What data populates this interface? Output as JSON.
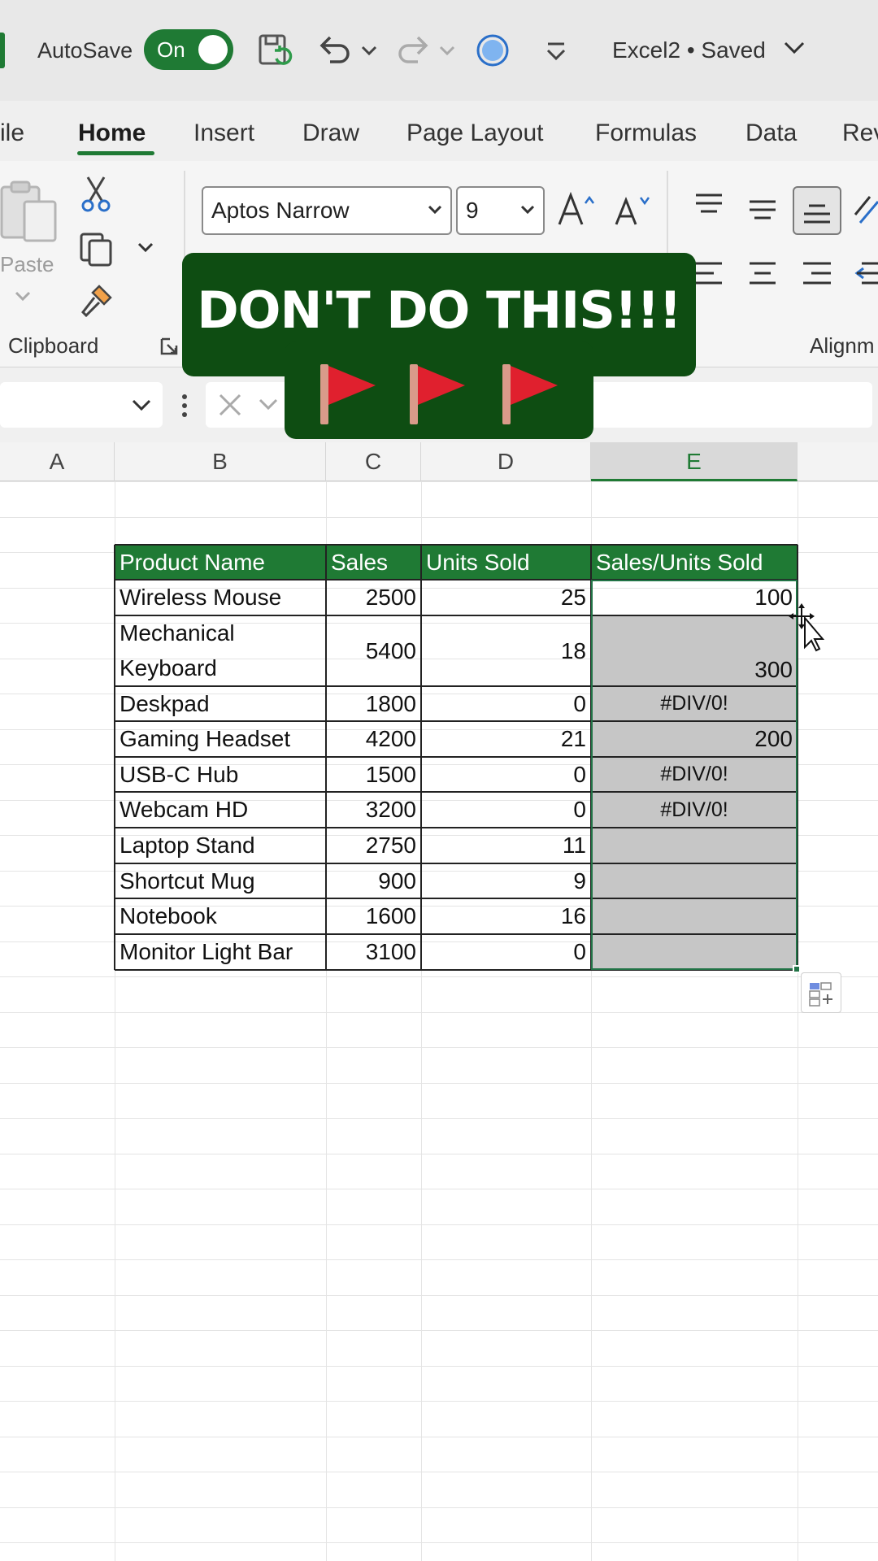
{
  "titlebar": {
    "autosave_label": "AutoSave",
    "autosave_state": "On",
    "document_title": "Excel2 • Saved"
  },
  "tabs": [
    "ile",
    "Home",
    "Insert",
    "Draw",
    "Page Layout",
    "Formulas",
    "Data",
    "Rev"
  ],
  "active_tab": "Home",
  "ribbon": {
    "paste_label": "Paste",
    "clipboard_label": "Clipboard",
    "alignment_label": "Alignm",
    "font_name": "Aptos Narrow",
    "font_size": "9"
  },
  "overlay": {
    "text": "DON'T DO THIS!!!"
  },
  "columns": [
    "A",
    "B",
    "C",
    "D",
    "E"
  ],
  "selected_column": "E",
  "table": {
    "headers": [
      "Product Name",
      "Sales",
      "Units Sold",
      "Sales/Units Sold"
    ],
    "rows": [
      {
        "name": "Wireless Mouse",
        "name2": "",
        "sales": "2500",
        "units": "25",
        "ratio": "100"
      },
      {
        "name": "Mechanical",
        "name2": "Keyboard",
        "sales": "5400",
        "units": "18",
        "ratio": "300"
      },
      {
        "name": "Deskpad",
        "name2": "",
        "sales": "1800",
        "units": "0",
        "ratio": "#DIV/0!"
      },
      {
        "name": "Gaming Headset",
        "name2": "",
        "sales": "4200",
        "units": "21",
        "ratio": "200"
      },
      {
        "name": "USB-C Hub",
        "name2": "",
        "sales": "1500",
        "units": "0",
        "ratio": "#DIV/0!"
      },
      {
        "name": "Webcam HD",
        "name2": "",
        "sales": "3200",
        "units": "0",
        "ratio": "#DIV/0!"
      },
      {
        "name": "Laptop Stand",
        "name2": "",
        "sales": "2750",
        "units": "11",
        "ratio": ""
      },
      {
        "name": "Shortcut Mug",
        "name2": "",
        "sales": "900",
        "units": "9",
        "ratio": ""
      },
      {
        "name": "Notebook",
        "name2": "",
        "sales": "1600",
        "units": "16",
        "ratio": ""
      },
      {
        "name": "Monitor Light Bar",
        "name2": "",
        "sales": "3100",
        "units": "0",
        "ratio": ""
      }
    ]
  },
  "colors": {
    "accent_green": "#1f7a34",
    "banner_green": "#0e4d12",
    "flag_red": "#e0202e",
    "selection_shade": "#c6c6c6"
  },
  "icons": [
    "save-sync-icon",
    "undo-icon",
    "redo-icon",
    "copilot-circle-icon",
    "customize-toolbar-icon",
    "paste-icon",
    "cut-icon",
    "copy-icon",
    "format-painter-icon",
    "red-flag-icon",
    "quick-analysis-icon",
    "move-cursor-icon"
  ]
}
